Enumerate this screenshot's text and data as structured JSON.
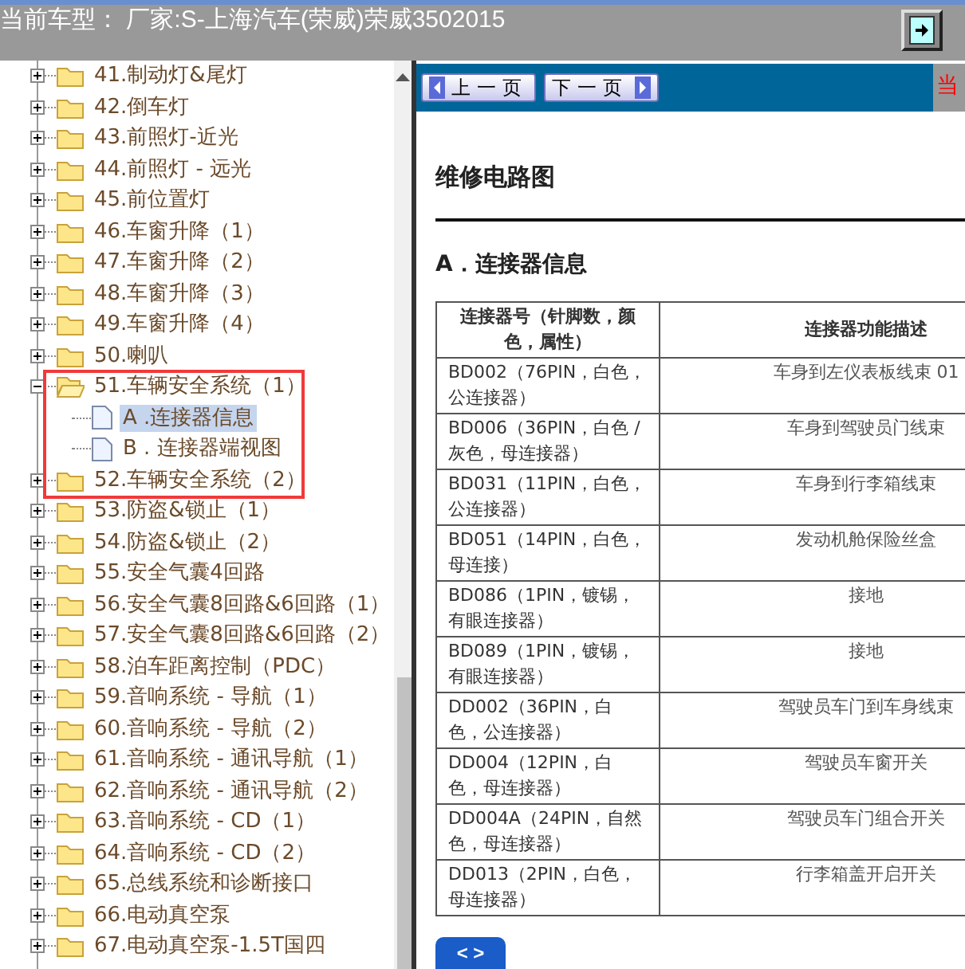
{
  "header": {
    "title": "当前车型： 厂家:S-上海汽车(荣威)荣威3502015"
  },
  "tree": {
    "items": [
      {
        "label": "41.制动灯&尾灯",
        "expanded": false,
        "selected": false
      },
      {
        "label": "42.倒车灯",
        "expanded": false,
        "selected": false
      },
      {
        "label": "43.前照灯-近光",
        "expanded": false,
        "selected": false
      },
      {
        "label": "44.前照灯 - 远光",
        "expanded": false,
        "selected": false
      },
      {
        "label": "45.前位置灯",
        "expanded": false,
        "selected": false
      },
      {
        "label": "46.车窗升降（1）",
        "expanded": false,
        "selected": false
      },
      {
        "label": "47.车窗升降（2）",
        "expanded": false,
        "selected": false
      },
      {
        "label": "48.车窗升降（3）",
        "expanded": false,
        "selected": false
      },
      {
        "label": "49.车窗升降（4）",
        "expanded": false,
        "selected": false
      },
      {
        "label": "50.喇叭",
        "expanded": false,
        "selected": false
      },
      {
        "label": "51.车辆安全系统（1）",
        "expanded": true,
        "selected": false,
        "children": [
          {
            "label": "A .连接器信息",
            "selected": true
          },
          {
            "label": "B . 连接器端视图",
            "selected": false
          }
        ]
      },
      {
        "label": "52.车辆安全系统（2）",
        "expanded": false,
        "selected": false
      },
      {
        "label": "53.防盗&锁止（1）",
        "expanded": false,
        "selected": false
      },
      {
        "label": "54.防盗&锁止（2）",
        "expanded": false,
        "selected": false
      },
      {
        "label": "55.安全气囊4回路",
        "expanded": false,
        "selected": false
      },
      {
        "label": "56.安全气囊8回路&6回路（1）",
        "expanded": false,
        "selected": false
      },
      {
        "label": "57.安全气囊8回路&6回路（2）",
        "expanded": false,
        "selected": false
      },
      {
        "label": "58.泊车距离控制（PDC）",
        "expanded": false,
        "selected": false
      },
      {
        "label": "59.音响系统 - 导航（1）",
        "expanded": false,
        "selected": false
      },
      {
        "label": "60.音响系统 - 导航（2）",
        "expanded": false,
        "selected": false
      },
      {
        "label": "61.音响系统 - 通讯导航（1）",
        "expanded": false,
        "selected": false
      },
      {
        "label": "62.音响系统 - 通讯导航（2）",
        "expanded": false,
        "selected": false
      },
      {
        "label": "63.音响系统 - CD（1）",
        "expanded": false,
        "selected": false
      },
      {
        "label": "64.音响系统 - CD（2）",
        "expanded": false,
        "selected": false
      },
      {
        "label": "65.总线系统和诊断接口",
        "expanded": false,
        "selected": false
      },
      {
        "label": "66.电动真空泵",
        "expanded": false,
        "selected": false
      },
      {
        "label": "67.电动真空泵-1.5T国四",
        "expanded": false,
        "selected": false
      }
    ]
  },
  "doc": {
    "nav_buttons": [
      {
        "label": "上一页",
        "kind": "prev"
      },
      {
        "label": "下一页",
        "kind": "next"
      }
    ],
    "side_text": "当",
    "heading": "维修电路图",
    "section": "A．连接器信息",
    "table": {
      "columns": [
        "连接器号（针脚数，颜色，属性）",
        "连接器功能描述"
      ],
      "rows": [
        [
          "BD002（76PIN，白色，公连接器）",
          "车身到左仪表板线束 01"
        ],
        [
          "BD006（36PIN，白色 / 灰色，母连接器）",
          "车身到驾驶员门线束"
        ],
        [
          "BD031（11PIN，白色，公连接器）",
          "车身到行李箱线束"
        ],
        [
          "BD051（14PIN，白色，母连接）",
          "发动机舱保险丝盒"
        ],
        [
          "BD086（1PIN，镀锡，有眼连接器）",
          "接地"
        ],
        [
          "BD089（1PIN，镀锡，有眼连接器）",
          "接地"
        ],
        [
          "DD002（36PIN，白色，公连接器）",
          "驾驶员车门到车身线束"
        ],
        [
          "DD004（12PIN，白色，母连接器）",
          "驾驶员车窗开关"
        ],
        [
          "DD004A（24PIN，自然色，母连接器）",
          "驾驶员车门组合开关"
        ],
        [
          "DD013（2PIN，白色，母连接器）",
          "行李箱盖开启开关"
        ]
      ]
    },
    "float_button": "< >"
  }
}
